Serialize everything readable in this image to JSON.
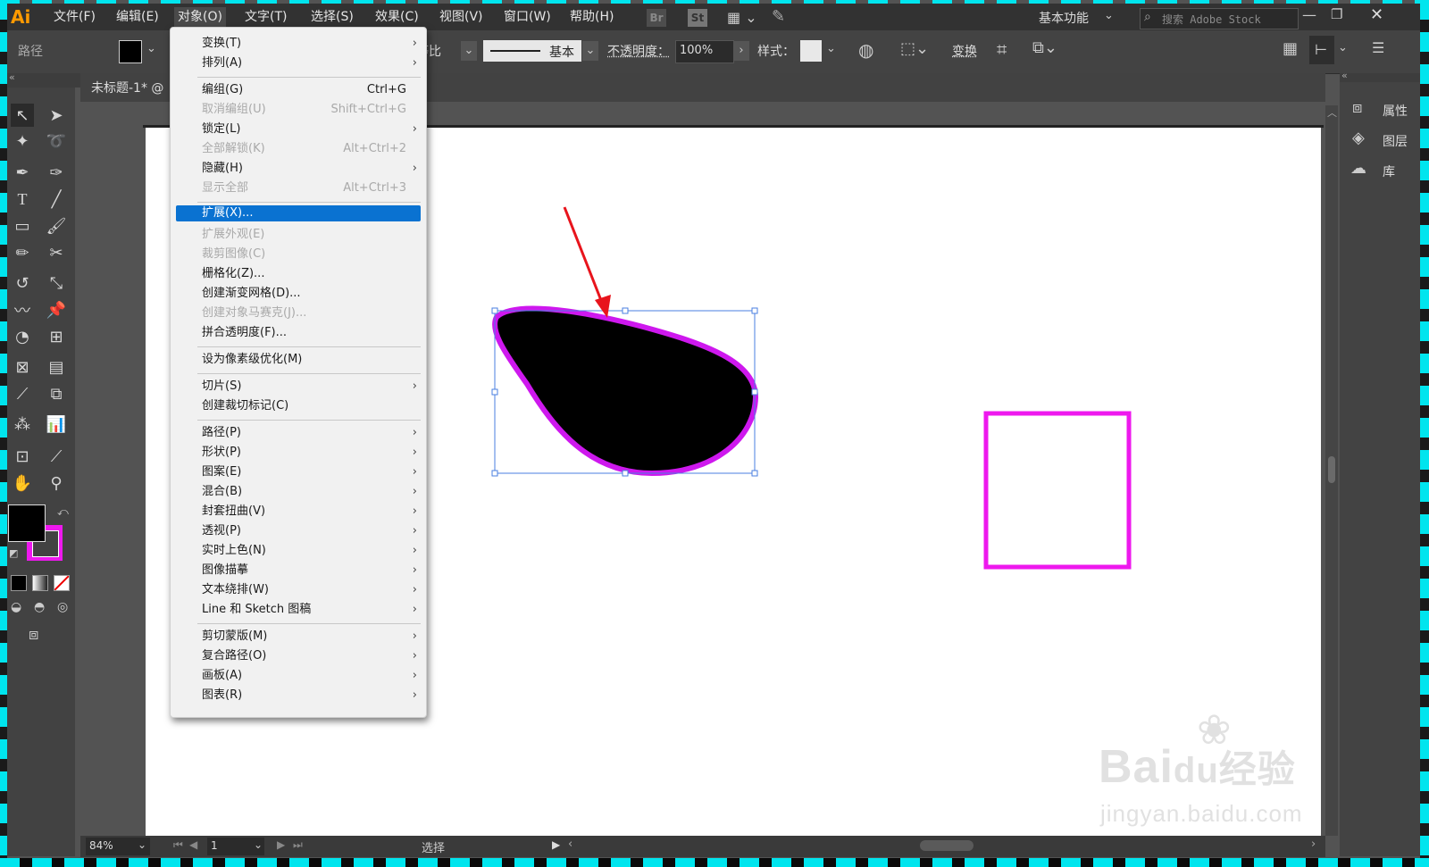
{
  "app": {
    "logo": "Ai",
    "workspace": "基本功能",
    "search_placeholder": "搜索 Adobe Stock"
  },
  "menubar": [
    "文件(F)",
    "编辑(E)",
    "对象(O)",
    "文字(T)",
    "选择(S)",
    "效果(C)",
    "视图(V)",
    "窗口(W)",
    "帮助(H)"
  ],
  "menubar_badges": {
    "br": "Br",
    "st": "St"
  },
  "controlbar": {
    "selection_label": "路径",
    "stroke_profile": "等比",
    "brush_label": "基本",
    "opacity_label": "不透明度：",
    "opacity_value": "100%",
    "style_label": "样式：",
    "transform_label": "变换"
  },
  "document": {
    "tab_title": "未标题-1* @"
  },
  "status": {
    "zoom": "84%",
    "artboard": "1",
    "tool": "选择"
  },
  "right_panel": [
    {
      "label": "属性",
      "icon": "properties-icon"
    },
    {
      "label": "图层",
      "icon": "layers-icon"
    },
    {
      "label": "库",
      "icon": "libraries-icon"
    }
  ],
  "object_menu": {
    "items": [
      {
        "label": "变换(T)",
        "shortcut": "",
        "submenu": true,
        "disabled": false
      },
      {
        "label": "排列(A)",
        "shortcut": "",
        "submenu": true,
        "disabled": false
      },
      {
        "label": "编组(G)",
        "shortcut": "Ctrl+G",
        "submenu": false,
        "disabled": false
      },
      {
        "label": "取消编组(U)",
        "shortcut": "Shift+Ctrl+G",
        "submenu": false,
        "disabled": true
      },
      {
        "label": "锁定(L)",
        "shortcut": "",
        "submenu": true,
        "disabled": false
      },
      {
        "label": "全部解锁(K)",
        "shortcut": "Alt+Ctrl+2",
        "submenu": false,
        "disabled": true
      },
      {
        "label": "隐藏(H)",
        "shortcut": "",
        "submenu": true,
        "disabled": false
      },
      {
        "label": "显示全部",
        "shortcut": "Alt+Ctrl+3",
        "submenu": false,
        "disabled": true
      },
      {
        "label": "扩展(X)...",
        "shortcut": "",
        "submenu": false,
        "disabled": false,
        "selected": true
      },
      {
        "label": "扩展外观(E)",
        "shortcut": "",
        "submenu": false,
        "disabled": true
      },
      {
        "label": "裁剪图像(C)",
        "shortcut": "",
        "submenu": false,
        "disabled": true
      },
      {
        "label": "栅格化(Z)...",
        "shortcut": "",
        "submenu": false,
        "disabled": false
      },
      {
        "label": "创建渐变网格(D)...",
        "shortcut": "",
        "submenu": false,
        "disabled": false
      },
      {
        "label": "创建对象马赛克(J)...",
        "shortcut": "",
        "submenu": false,
        "disabled": true
      },
      {
        "label": "拼合透明度(F)...",
        "shortcut": "",
        "submenu": false,
        "disabled": false
      },
      {
        "label": "设为像素级优化(M)",
        "shortcut": "",
        "submenu": false,
        "disabled": false
      },
      {
        "label": "切片(S)",
        "shortcut": "",
        "submenu": true,
        "disabled": false
      },
      {
        "label": "创建裁切标记(C)",
        "shortcut": "",
        "submenu": false,
        "disabled": false
      },
      {
        "label": "路径(P)",
        "shortcut": "",
        "submenu": true,
        "disabled": false
      },
      {
        "label": "形状(P)",
        "shortcut": "",
        "submenu": true,
        "disabled": false
      },
      {
        "label": "图案(E)",
        "shortcut": "",
        "submenu": true,
        "disabled": false
      },
      {
        "label": "混合(B)",
        "shortcut": "",
        "submenu": true,
        "disabled": false
      },
      {
        "label": "封套扭曲(V)",
        "shortcut": "",
        "submenu": true,
        "disabled": false
      },
      {
        "label": "透视(P)",
        "shortcut": "",
        "submenu": true,
        "disabled": false
      },
      {
        "label": "实时上色(N)",
        "shortcut": "",
        "submenu": true,
        "disabled": false
      },
      {
        "label": "图像描摹",
        "shortcut": "",
        "submenu": true,
        "disabled": false
      },
      {
        "label": "文本绕排(W)",
        "shortcut": "",
        "submenu": true,
        "disabled": false
      },
      {
        "label": "Line 和 Sketch 图稿",
        "shortcut": "",
        "submenu": true,
        "disabled": false
      },
      {
        "label": "剪切蒙版(M)",
        "shortcut": "",
        "submenu": true,
        "disabled": false
      },
      {
        "label": "复合路径(O)",
        "shortcut": "",
        "submenu": true,
        "disabled": false
      },
      {
        "label": "画板(A)",
        "shortcut": "",
        "submenu": true,
        "disabled": false
      },
      {
        "label": "图表(R)",
        "shortcut": "",
        "submenu": true,
        "disabled": false
      }
    ]
  },
  "watermark": {
    "brand": "Bai",
    "brand2": "du",
    "cn": "经验",
    "url": "jingyan.baidu.com"
  },
  "colors": {
    "accent": "#0a72d1",
    "magenta": "#ee18ee",
    "annotation": "#e8141c",
    "selection": "#4a7fe0"
  }
}
